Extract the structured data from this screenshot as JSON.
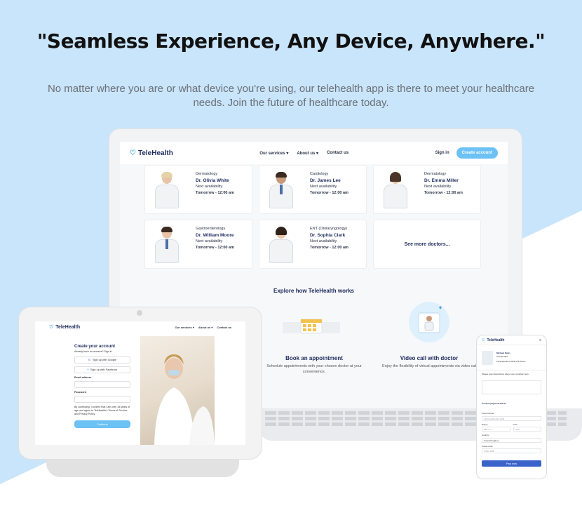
{
  "headline": "\"Seamless Experience, Any Device, Anywhere.\"",
  "subhead": "No matter where you are or what device you're using, our telehealth app is there to meet your healthcare needs. Join the future of healthcare today.",
  "colors": {
    "accent": "#6cc1f5",
    "navy": "#1d2a5c",
    "bg_blue": "#c9e5fb"
  },
  "laptop": {
    "logo": "TeleHealth",
    "nav": [
      "Our services ▾",
      "About us ▾",
      "Contact us"
    ],
    "sign_in": "Sign in",
    "create_account": "Create account",
    "doctors": [
      {
        "specialty": "Dermatology",
        "name": "Dr. Olivia White",
        "availability_label": "Next availability",
        "time": "Tomorrow - 12:00 am"
      },
      {
        "specialty": "Cardiology",
        "name": "Dr. James Lee",
        "availability_label": "Next availability",
        "time": "Tomorrow - 12:00 am"
      },
      {
        "specialty": "Dermatology",
        "name": "Dr. Emma Miller",
        "availability_label": "Next availability",
        "time": "Tomorrow - 12:00 am"
      },
      {
        "specialty": "Gastroenterology",
        "name": "Dr. William Moore",
        "availability_label": "Next availability",
        "time": "Tomorrow - 12:00 am"
      },
      {
        "specialty": "ENT (Otolaryngology)",
        "name": "Dr. Sophia Clark",
        "availability_label": "Next availability",
        "time": "Tomorrow - 12:00 am"
      }
    ],
    "see_more": "See more doctors...",
    "explore_title": "Explore how TeleHealth works",
    "features": [
      {
        "title": "Book an appointment",
        "desc": "Schedule appointments with your chosen doctor at your convenience."
      },
      {
        "title": "Video call with doctor",
        "desc": "Enjoy the flexibility of virtual appointments via video cal"
      }
    ]
  },
  "hub": {
    "logo": "TeleHealth",
    "nav": [
      "Our services ▾",
      "About us ▾",
      "Contact us"
    ],
    "form_title": "Create your account",
    "already": "Already have an account? Sign in",
    "google": "Sign up with Google",
    "facebook": "Sign up with Facebook",
    "email_label": "Email address",
    "password_label": "Password",
    "terms": "By continuing, I confirm that I am over 18 years of age and agree to TeleHealth's Terms of Service and Privacy Policy",
    "continue": "Continue"
  },
  "phone": {
    "logo": "TeleHealth",
    "doctor_name": "Michael Davis",
    "doctor_specialty": "Orthopedics",
    "appointment": "19 September 2023 at 8:00 am",
    "describe_label": "Please enter description about your condition here",
    "confirm_label": "Confirm payment £61.50",
    "card_label": "Card number",
    "card_placeholder": "1234 1234 1234 1234",
    "expiry_label": "Expiry",
    "expiry_placeholder": "MM / YY",
    "cvc_label": "CVC",
    "cvc_placeholder": "CVC",
    "country_label": "Country",
    "country_value": "United Kingdom",
    "postal_label": "Postal code",
    "postal_placeholder": "WS11 1DB",
    "pay": "Pay now"
  }
}
